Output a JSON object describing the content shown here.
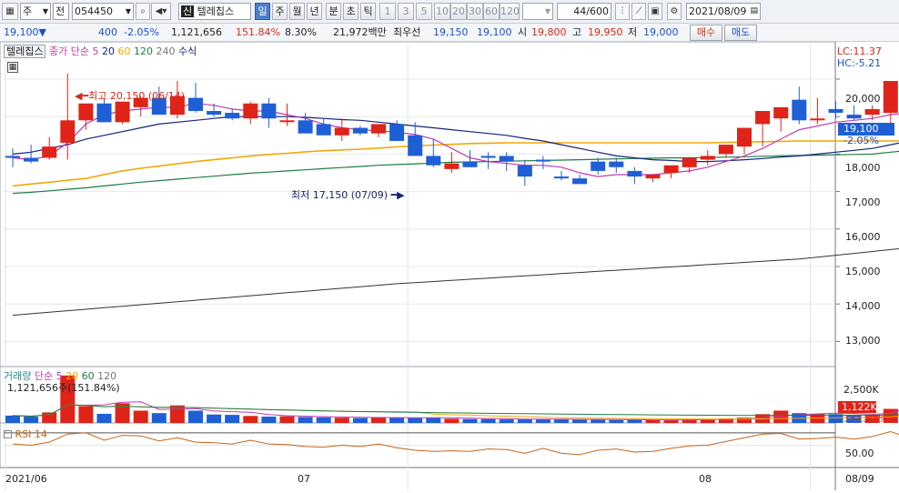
{
  "toolbar": {
    "tab_label": "주",
    "ctrl_label": "전",
    "code": "054450",
    "name_prefix": "신",
    "name": "텔레칩스",
    "periods": [
      "일",
      "주",
      "월",
      "년",
      "분",
      "초",
      "틱"
    ],
    "active_period": "일",
    "nums": [
      "1",
      "3",
      "5",
      "10",
      "20",
      "30",
      "60",
      "120"
    ],
    "count": "44/600",
    "date": "2021/08/09"
  },
  "quote": {
    "price": "19,100",
    "arrow": "▼",
    "change": "400",
    "change_pct": "-2.05%",
    "volume": "1,121,656",
    "volume_pct": "151.84%",
    "turnover": "8.30%",
    "amount": "21,972백만",
    "best_label": "최우선",
    "best_ask": "19,150",
    "best_bid": "19,100",
    "open_label": "시",
    "open": "19,800",
    "high_label": "고",
    "high": "19,950",
    "low_label": "저",
    "low": "19,000",
    "buy_label": "매수",
    "sell_label": "매도"
  },
  "legend": {
    "name": "텔레칩스",
    "ma_label": "종가 단순",
    "periods": [
      "5",
      "20",
      "60",
      "120",
      "240"
    ],
    "formula": "수식",
    "lc": "LC:11.37",
    "hc": "HC:-5.21"
  },
  "annotations": {
    "high": "최고 20,150 (06/14)",
    "low": "최저 17,150 (07/09)"
  },
  "price_axis": {
    "ticks": [
      "20,000",
      "19,000",
      "18,000",
      "17,000",
      "16,000",
      "15,000",
      "14,000",
      "13,000"
    ],
    "current": "19,100",
    "current_pct": "-2.05%"
  },
  "volume_panel": {
    "title": "거래량",
    "ma_label": "단순",
    "periods": [
      "5",
      "20",
      "60",
      "120"
    ],
    "info": "1,121,656주(151.84%)",
    "tick": "2,500K",
    "current": "1,122K",
    "current_pct": "151.84%"
  },
  "rsi_panel": {
    "title": "RSI 14",
    "tick": "50.00"
  },
  "date_axis": {
    "labels": [
      "2021/06",
      "07",
      "08",
      "08/09"
    ]
  },
  "colors": {
    "up": "#e02318",
    "down": "#1f5fd6",
    "ma5": "#c03bb0",
    "ma20": "#15237a",
    "ma60": "#f0a808",
    "ma120": "#1e7c45",
    "ma240": "#333333"
  },
  "chart_data": {
    "type": "candlestick",
    "dates": [
      "06/01",
      "06/02",
      "06/03",
      "06/04",
      "06/07",
      "06/08",
      "06/09",
      "06/10",
      "06/11",
      "06/14",
      "06/15",
      "06/16",
      "06/17",
      "06/18",
      "06/21",
      "06/22",
      "06/23",
      "06/24",
      "06/25",
      "06/28",
      "06/29",
      "06/30",
      "07/01",
      "07/02",
      "07/05",
      "07/06",
      "07/07",
      "07/08",
      "07/09",
      "07/12",
      "07/13",
      "07/14",
      "07/15",
      "07/16",
      "07/19",
      "07/20",
      "07/21",
      "07/22",
      "07/23",
      "07/26",
      "07/27",
      "07/28",
      "07/29",
      "07/30",
      "08/02",
      "08/03",
      "08/04",
      "08/05",
      "08/06",
      "08/09"
    ],
    "open": [
      17950,
      17900,
      17900,
      18300,
      18900,
      19350,
      18850,
      19250,
      19500,
      19050,
      19500,
      19150,
      19100,
      18950,
      19350,
      18900,
      18900,
      18800,
      18500,
      18700,
      18550,
      18800,
      18500,
      17950,
      17600,
      17800,
      17950,
      17950,
      17700,
      17850,
      17400,
      17350,
      17800,
      17800,
      17550,
      17350,
      17500,
      17650,
      17850,
      18000,
      18200,
      18800,
      18950,
      19450,
      18900,
      19200,
      19050,
      19050,
      19100,
      19100
    ],
    "high": [
      18150,
      18250,
      18450,
      20150,
      19200,
      19500,
      19350,
      19550,
      19800,
      19950,
      19900,
      19350,
      19200,
      19400,
      19500,
      19350,
      19100,
      18950,
      18950,
      18750,
      18650,
      18900,
      18850,
      18400,
      18050,
      18100,
      18050,
      18050,
      17850,
      17950,
      17550,
      17450,
      17900,
      17900,
      17650,
      17400,
      17500,
      17850,
      18100,
      18200,
      18400,
      19050,
      19200,
      19800,
      19500,
      19400,
      19300,
      19300,
      19950,
      19950
    ],
    "high_marked": [
      false,
      false,
      false,
      true,
      false,
      false,
      false,
      false,
      false,
      true,
      false,
      false,
      false,
      false,
      false,
      false,
      false,
      false,
      false,
      false,
      false,
      false,
      false,
      false,
      false,
      false,
      false,
      false,
      false,
      false,
      false,
      false,
      false,
      false,
      false,
      false,
      false,
      false,
      false,
      false,
      false,
      false,
      false,
      false,
      false,
      false,
      false,
      false,
      false,
      false
    ],
    "low": [
      17650,
      17750,
      17850,
      17850,
      18650,
      18850,
      18800,
      19000,
      19050,
      18950,
      19100,
      19000,
      18900,
      18800,
      18700,
      18750,
      18650,
      18650,
      18350,
      18500,
      18450,
      18550,
      18200,
      17650,
      17500,
      17650,
      17600,
      17550,
      17150,
      17600,
      17300,
      17250,
      17450,
      17500,
      17200,
      17250,
      17350,
      17500,
      17700,
      17900,
      18000,
      18200,
      18600,
      18800,
      18800,
      18950,
      18900,
      18900,
      18650,
      19000
    ],
    "close": [
      17900,
      17800,
      18200,
      18900,
      19350,
      18850,
      19400,
      19500,
      19050,
      19550,
      19150,
      19050,
      18950,
      19350,
      18950,
      18900,
      18550,
      18500,
      18700,
      18550,
      18800,
      18350,
      17950,
      17700,
      17750,
      17650,
      17900,
      17800,
      17400,
      17800,
      17350,
      17200,
      17550,
      17650,
      17400,
      17450,
      17700,
      17900,
      17950,
      18250,
      18700,
      19150,
      19250,
      18900,
      18950,
      19100,
      18950,
      19200,
      19950,
      19100
    ],
    "volume": [
      210000,
      180000,
      300000,
      1350000,
      480000,
      260000,
      560000,
      350000,
      280000,
      500000,
      350000,
      240000,
      230000,
      200000,
      180000,
      190000,
      170000,
      160000,
      150000,
      140000,
      160000,
      150000,
      140000,
      150000,
      120000,
      110000,
      110000,
      100000,
      100000,
      110000,
      110000,
      90000,
      90000,
      80000,
      95000,
      80000,
      85000,
      95000,
      110000,
      130000,
      150000,
      250000,
      350000,
      280000,
      260000,
      250000,
      220000,
      230000,
      400000,
      1121656
    ],
    "ma5": [
      17900,
      17850,
      17950,
      18300,
      18800,
      19050,
      19150,
      19200,
      19250,
      19250,
      19350,
      19300,
      19200,
      19150,
      19150,
      19050,
      18950,
      18800,
      18700,
      18650,
      18620,
      18580,
      18520,
      18400,
      18150,
      17900,
      17800,
      17750,
      17700,
      17700,
      17650,
      17500,
      17400,
      17450,
      17450,
      17450,
      17500,
      17550,
      17650,
      17800,
      17950,
      18150,
      18400,
      18650,
      18750,
      18850,
      18900,
      18950,
      19050,
      19100
    ],
    "ma20": [
      18000,
      18050,
      18150,
      18250,
      18400,
      18500,
      18600,
      18700,
      18800,
      18850,
      18900,
      18950,
      19000,
      19000,
      19000,
      19000,
      18980,
      18950,
      18920,
      18900,
      18850,
      18800,
      18750,
      18700,
      18650,
      18600,
      18550,
      18500,
      18420,
      18350,
      18250,
      18150,
      18050,
      17950,
      17900,
      17850,
      17830,
      17800,
      17800,
      17820,
      17850,
      17880,
      17920,
      17950,
      18000,
      18050,
      18100,
      18150,
      18250,
      18350
    ],
    "ma60": [
      17150,
      17200,
      17250,
      17300,
      17350,
      17450,
      17550,
      17620,
      17680,
      17740,
      17800,
      17850,
      17900,
      17950,
      17990,
      18020,
      18060,
      18090,
      18110,
      18130,
      18160,
      18190,
      18220,
      18240,
      18260,
      18280,
      18290,
      18300,
      18300,
      18300,
      18300,
      18300,
      18300,
      18300,
      18300,
      18300,
      18300,
      18300,
      18300,
      18310,
      18320,
      18330,
      18340,
      18350,
      18350,
      18350,
      18350,
      18350,
      18350,
      18350
    ],
    "ma120": [
      16950,
      16980,
      17020,
      17060,
      17100,
      17150,
      17200,
      17250,
      17290,
      17330,
      17370,
      17410,
      17450,
      17490,
      17520,
      17550,
      17580,
      17610,
      17640,
      17670,
      17700,
      17720,
      17740,
      17760,
      17780,
      17790,
      17800,
      17810,
      17820,
      17830,
      17840,
      17850,
      17860,
      17870,
      17880,
      17890,
      17900,
      17900,
      17910,
      17920,
      17930,
      17940,
      17950,
      17960,
      17970,
      17980,
      17990,
      18000,
      18050,
      18100
    ],
    "ma240": [
      13700,
      13740,
      13780,
      13820,
      13860,
      13900,
      13940,
      13980,
      14020,
      14060,
      14100,
      14140,
      14180,
      14220,
      14260,
      14300,
      14340,
      14380,
      14420,
      14460,
      14500,
      14540,
      14570,
      14600,
      14630,
      14660,
      14690,
      14720,
      14750,
      14780,
      14810,
      14840,
      14870,
      14900,
      14930,
      14960,
      14990,
      15020,
      15050,
      15080,
      15110,
      15140,
      15170,
      15200,
      15250,
      15300,
      15350,
      15400,
      15450,
      15500
    ],
    "rsi": [
      52,
      50,
      55,
      68,
      70,
      58,
      66,
      65,
      57,
      62,
      55,
      54,
      52,
      58,
      52,
      51,
      48,
      47,
      50,
      48,
      52,
      46,
      42,
      40,
      41,
      40,
      44,
      43,
      37,
      45,
      37,
      35,
      42,
      44,
      39,
      40,
      45,
      49,
      50,
      56,
      62,
      68,
      69,
      60,
      61,
      63,
      60,
      64,
      72,
      62
    ],
    "ylim": [
      12500,
      20800
    ],
    "ylabel": "",
    "xlabel": ""
  }
}
